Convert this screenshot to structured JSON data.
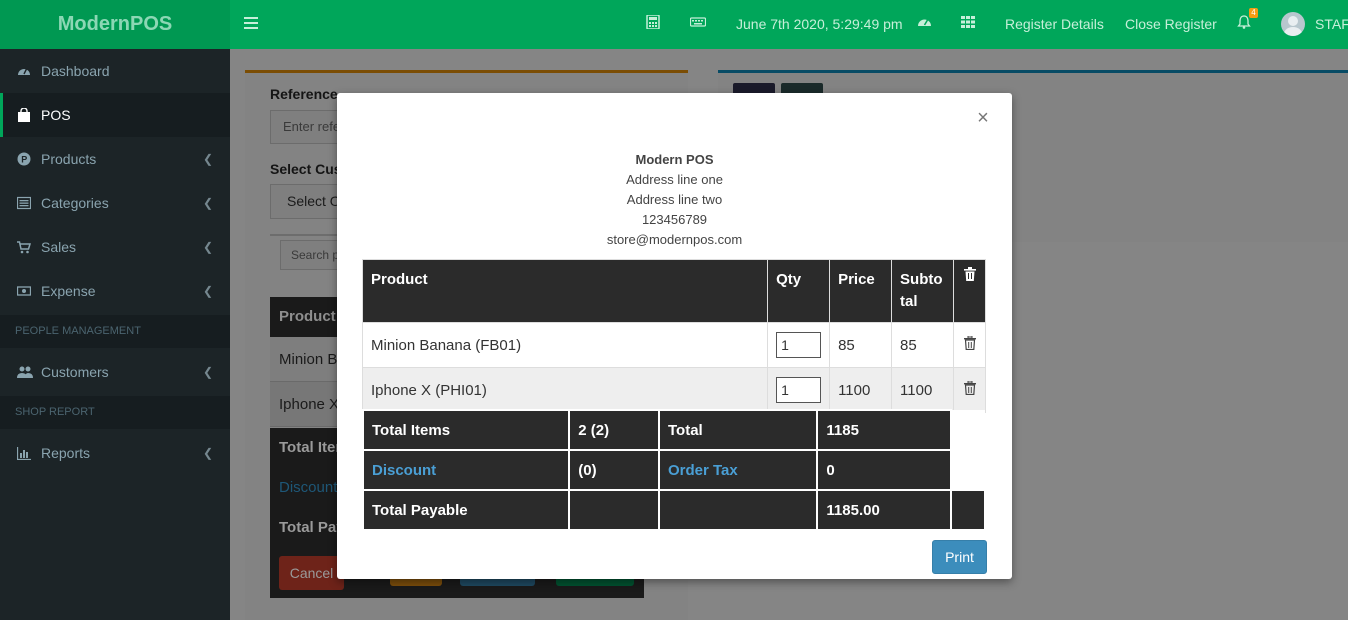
{
  "header": {
    "logo": "ModernPOS",
    "datetime": "June 7th 2020, 5:29:49 pm",
    "register_details": "Register Details",
    "close_register": "Close Register",
    "notification_count": "4",
    "user": "STAFF"
  },
  "sidebar": {
    "items": [
      {
        "label": "Dashboard"
      },
      {
        "label": "POS"
      },
      {
        "label": "Products"
      },
      {
        "label": "Categories"
      },
      {
        "label": "Sales"
      },
      {
        "label": "Expense"
      }
    ],
    "section_people": "PEOPLE MANAGEMENT",
    "customers": "Customers",
    "section_shop": "SHOP REPORT",
    "reports": "Reports"
  },
  "background": {
    "reference_label": "Reference",
    "reference_placeholder": "Enter refe",
    "select_customer_label": "Select Cust",
    "select_customer_value": "Select O",
    "search_placeholder": "Search pr",
    "product_header": "Product",
    "row1": "Minion B",
    "row2": "Iphone X",
    "total_items": "Total Item",
    "discount": "Discount",
    "total_payable": "Total Pay",
    "cancel": "Cancel"
  },
  "modal": {
    "store_name": "Modern POS",
    "address1": "Address line one",
    "address2": "Address line two",
    "phone": "123456789",
    "email": "store@modernpos.com",
    "columns": {
      "product": "Product",
      "qty": "Qty",
      "price": "Price",
      "subtotal_1": "Subto",
      "subtotal_2": "tal"
    },
    "items": [
      {
        "product": "Minion Banana (FB01)",
        "qty": "1",
        "price": "85",
        "subtotal": "85"
      },
      {
        "product": "Iphone X (PHI01)",
        "qty": "1",
        "price": "1100",
        "subtotal": "1100"
      }
    ],
    "totals": {
      "total_items_label": "Total Items",
      "total_items_value": "2 (2)",
      "total_label": "Total",
      "total_value": "1185",
      "discount_label": "Discount",
      "discount_value": "(0)",
      "order_tax_label": "Order Tax",
      "order_tax_value": "0",
      "total_payable_label": "Total Payable",
      "total_payable_value": "1185.00"
    },
    "print_label": "Print"
  }
}
